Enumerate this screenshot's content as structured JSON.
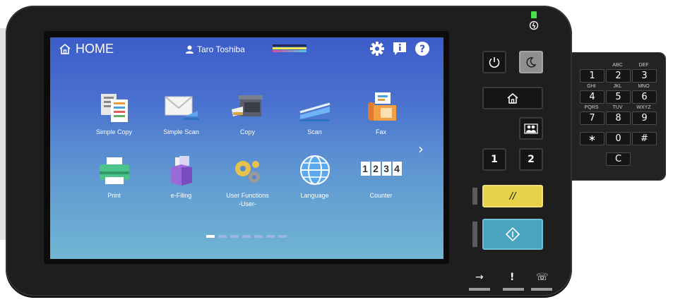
{
  "header": {
    "title": "HOME",
    "user_name": "Taro Toshiba"
  },
  "icons": {
    "home": "home-icon",
    "user": "user-icon",
    "settings": "gear-icon",
    "info": "info-icon",
    "help": "help-icon"
  },
  "apps_row1": [
    {
      "label": "Simple Copy"
    },
    {
      "label": "Simple Scan"
    },
    {
      "label": "Copy"
    },
    {
      "label": "Scan"
    },
    {
      "label": "Fax"
    }
  ],
  "apps_row2": [
    {
      "label": "Print"
    },
    {
      "label": "e-Filing"
    },
    {
      "label": "User Functions\n-User-"
    },
    {
      "label": "Language"
    },
    {
      "label": "Counter"
    }
  ],
  "counter_digits": [
    "1",
    "2",
    "3",
    "4"
  ],
  "pager": {
    "pages": 7,
    "current": 1
  },
  "next_glyph": "›",
  "hardware": {
    "job1": "1",
    "job2": "2",
    "reset_glyph": "//",
    "status_symbols": [
      "→",
      "!",
      "☏"
    ]
  },
  "keypad": {
    "keys": [
      {
        "label": "1",
        "sub": ""
      },
      {
        "label": "2",
        "sub": "ABC"
      },
      {
        "label": "3",
        "sub": "DEF"
      },
      {
        "label": "4",
        "sub": "GHI"
      },
      {
        "label": "5",
        "sub": "JKL"
      },
      {
        "label": "6",
        "sub": "MNO"
      },
      {
        "label": "7",
        "sub": "PQRS"
      },
      {
        "label": "8",
        "sub": "TUV"
      },
      {
        "label": "9",
        "sub": "WXYZ"
      },
      {
        "label": "∗",
        "sub": ""
      },
      {
        "label": "0",
        "sub": ""
      },
      {
        "label": "#",
        "sub": ""
      }
    ],
    "clear": "C"
  },
  "colors": {
    "reset_button": "#e8d24a",
    "start_button": "#4aa3bf",
    "power_led": "#46e04a"
  }
}
